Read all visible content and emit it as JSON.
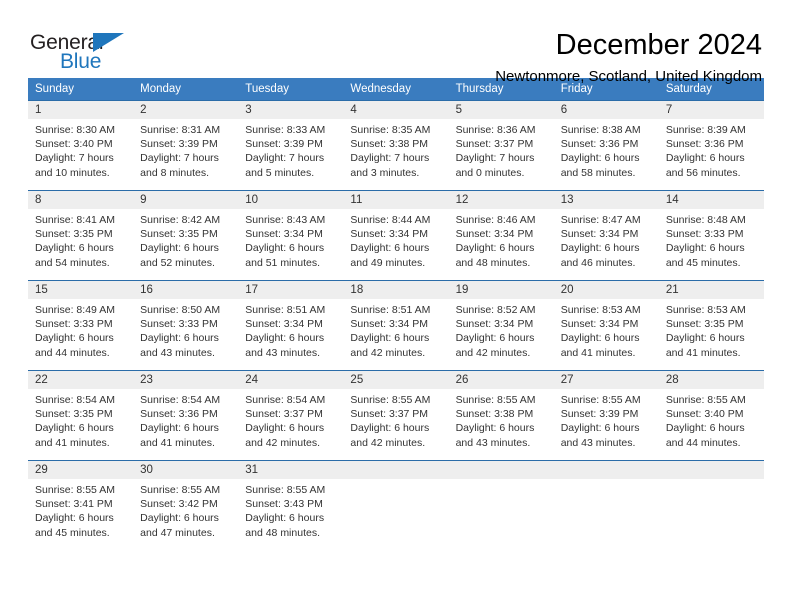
{
  "brand": {
    "name_part1": "General",
    "name_part2": "Blue",
    "triangle_icon": "triangle-icon",
    "color_dark": "#231f20",
    "color_blue": "#1f76bc"
  },
  "header": {
    "title": "December 2024",
    "subtitle": "Newtonmore, Scotland, United Kingdom"
  },
  "theme": {
    "header_bg": "#3a7cbf",
    "header_text": "#ffffff",
    "daynum_bg": "#eeeeee",
    "separator": "#2b6ca8",
    "body_text": "#333333"
  },
  "weekdays": [
    "Sunday",
    "Monday",
    "Tuesday",
    "Wednesday",
    "Thursday",
    "Friday",
    "Saturday"
  ],
  "weeks": [
    {
      "days": [
        {
          "num": "1",
          "sunrise": "Sunrise: 8:30 AM",
          "sunset": "Sunset: 3:40 PM",
          "daylight1": "Daylight: 7 hours",
          "daylight2": "and 10 minutes."
        },
        {
          "num": "2",
          "sunrise": "Sunrise: 8:31 AM",
          "sunset": "Sunset: 3:39 PM",
          "daylight1": "Daylight: 7 hours",
          "daylight2": "and 8 minutes."
        },
        {
          "num": "3",
          "sunrise": "Sunrise: 8:33 AM",
          "sunset": "Sunset: 3:39 PM",
          "daylight1": "Daylight: 7 hours",
          "daylight2": "and 5 minutes."
        },
        {
          "num": "4",
          "sunrise": "Sunrise: 8:35 AM",
          "sunset": "Sunset: 3:38 PM",
          "daylight1": "Daylight: 7 hours",
          "daylight2": "and 3 minutes."
        },
        {
          "num": "5",
          "sunrise": "Sunrise: 8:36 AM",
          "sunset": "Sunset: 3:37 PM",
          "daylight1": "Daylight: 7 hours",
          "daylight2": "and 0 minutes."
        },
        {
          "num": "6",
          "sunrise": "Sunrise: 8:38 AM",
          "sunset": "Sunset: 3:36 PM",
          "daylight1": "Daylight: 6 hours",
          "daylight2": "and 58 minutes."
        },
        {
          "num": "7",
          "sunrise": "Sunrise: 8:39 AM",
          "sunset": "Sunset: 3:36 PM",
          "daylight1": "Daylight: 6 hours",
          "daylight2": "and 56 minutes."
        }
      ]
    },
    {
      "days": [
        {
          "num": "8",
          "sunrise": "Sunrise: 8:41 AM",
          "sunset": "Sunset: 3:35 PM",
          "daylight1": "Daylight: 6 hours",
          "daylight2": "and 54 minutes."
        },
        {
          "num": "9",
          "sunrise": "Sunrise: 8:42 AM",
          "sunset": "Sunset: 3:35 PM",
          "daylight1": "Daylight: 6 hours",
          "daylight2": "and 52 minutes."
        },
        {
          "num": "10",
          "sunrise": "Sunrise: 8:43 AM",
          "sunset": "Sunset: 3:34 PM",
          "daylight1": "Daylight: 6 hours",
          "daylight2": "and 51 minutes."
        },
        {
          "num": "11",
          "sunrise": "Sunrise: 8:44 AM",
          "sunset": "Sunset: 3:34 PM",
          "daylight1": "Daylight: 6 hours",
          "daylight2": "and 49 minutes."
        },
        {
          "num": "12",
          "sunrise": "Sunrise: 8:46 AM",
          "sunset": "Sunset: 3:34 PM",
          "daylight1": "Daylight: 6 hours",
          "daylight2": "and 48 minutes."
        },
        {
          "num": "13",
          "sunrise": "Sunrise: 8:47 AM",
          "sunset": "Sunset: 3:34 PM",
          "daylight1": "Daylight: 6 hours",
          "daylight2": "and 46 minutes."
        },
        {
          "num": "14",
          "sunrise": "Sunrise: 8:48 AM",
          "sunset": "Sunset: 3:33 PM",
          "daylight1": "Daylight: 6 hours",
          "daylight2": "and 45 minutes."
        }
      ]
    },
    {
      "days": [
        {
          "num": "15",
          "sunrise": "Sunrise: 8:49 AM",
          "sunset": "Sunset: 3:33 PM",
          "daylight1": "Daylight: 6 hours",
          "daylight2": "and 44 minutes."
        },
        {
          "num": "16",
          "sunrise": "Sunrise: 8:50 AM",
          "sunset": "Sunset: 3:33 PM",
          "daylight1": "Daylight: 6 hours",
          "daylight2": "and 43 minutes."
        },
        {
          "num": "17",
          "sunrise": "Sunrise: 8:51 AM",
          "sunset": "Sunset: 3:34 PM",
          "daylight1": "Daylight: 6 hours",
          "daylight2": "and 43 minutes."
        },
        {
          "num": "18",
          "sunrise": "Sunrise: 8:51 AM",
          "sunset": "Sunset: 3:34 PM",
          "daylight1": "Daylight: 6 hours",
          "daylight2": "and 42 minutes."
        },
        {
          "num": "19",
          "sunrise": "Sunrise: 8:52 AM",
          "sunset": "Sunset: 3:34 PM",
          "daylight1": "Daylight: 6 hours",
          "daylight2": "and 42 minutes."
        },
        {
          "num": "20",
          "sunrise": "Sunrise: 8:53 AM",
          "sunset": "Sunset: 3:34 PM",
          "daylight1": "Daylight: 6 hours",
          "daylight2": "and 41 minutes."
        },
        {
          "num": "21",
          "sunrise": "Sunrise: 8:53 AM",
          "sunset": "Sunset: 3:35 PM",
          "daylight1": "Daylight: 6 hours",
          "daylight2": "and 41 minutes."
        }
      ]
    },
    {
      "days": [
        {
          "num": "22",
          "sunrise": "Sunrise: 8:54 AM",
          "sunset": "Sunset: 3:35 PM",
          "daylight1": "Daylight: 6 hours",
          "daylight2": "and 41 minutes."
        },
        {
          "num": "23",
          "sunrise": "Sunrise: 8:54 AM",
          "sunset": "Sunset: 3:36 PM",
          "daylight1": "Daylight: 6 hours",
          "daylight2": "and 41 minutes."
        },
        {
          "num": "24",
          "sunrise": "Sunrise: 8:54 AM",
          "sunset": "Sunset: 3:37 PM",
          "daylight1": "Daylight: 6 hours",
          "daylight2": "and 42 minutes."
        },
        {
          "num": "25",
          "sunrise": "Sunrise: 8:55 AM",
          "sunset": "Sunset: 3:37 PM",
          "daylight1": "Daylight: 6 hours",
          "daylight2": "and 42 minutes."
        },
        {
          "num": "26",
          "sunrise": "Sunrise: 8:55 AM",
          "sunset": "Sunset: 3:38 PM",
          "daylight1": "Daylight: 6 hours",
          "daylight2": "and 43 minutes."
        },
        {
          "num": "27",
          "sunrise": "Sunrise: 8:55 AM",
          "sunset": "Sunset: 3:39 PM",
          "daylight1": "Daylight: 6 hours",
          "daylight2": "and 43 minutes."
        },
        {
          "num": "28",
          "sunrise": "Sunrise: 8:55 AM",
          "sunset": "Sunset: 3:40 PM",
          "daylight1": "Daylight: 6 hours",
          "daylight2": "and 44 minutes."
        }
      ]
    },
    {
      "days": [
        {
          "num": "29",
          "sunrise": "Sunrise: 8:55 AM",
          "sunset": "Sunset: 3:41 PM",
          "daylight1": "Daylight: 6 hours",
          "daylight2": "and 45 minutes."
        },
        {
          "num": "30",
          "sunrise": "Sunrise: 8:55 AM",
          "sunset": "Sunset: 3:42 PM",
          "daylight1": "Daylight: 6 hours",
          "daylight2": "and 47 minutes."
        },
        {
          "num": "31",
          "sunrise": "Sunrise: 8:55 AM",
          "sunset": "Sunset: 3:43 PM",
          "daylight1": "Daylight: 6 hours",
          "daylight2": "and 48 minutes."
        },
        {
          "num": "",
          "sunrise": "",
          "sunset": "",
          "daylight1": "",
          "daylight2": ""
        },
        {
          "num": "",
          "sunrise": "",
          "sunset": "",
          "daylight1": "",
          "daylight2": ""
        },
        {
          "num": "",
          "sunrise": "",
          "sunset": "",
          "daylight1": "",
          "daylight2": ""
        },
        {
          "num": "",
          "sunrise": "",
          "sunset": "",
          "daylight1": "",
          "daylight2": ""
        }
      ]
    }
  ]
}
